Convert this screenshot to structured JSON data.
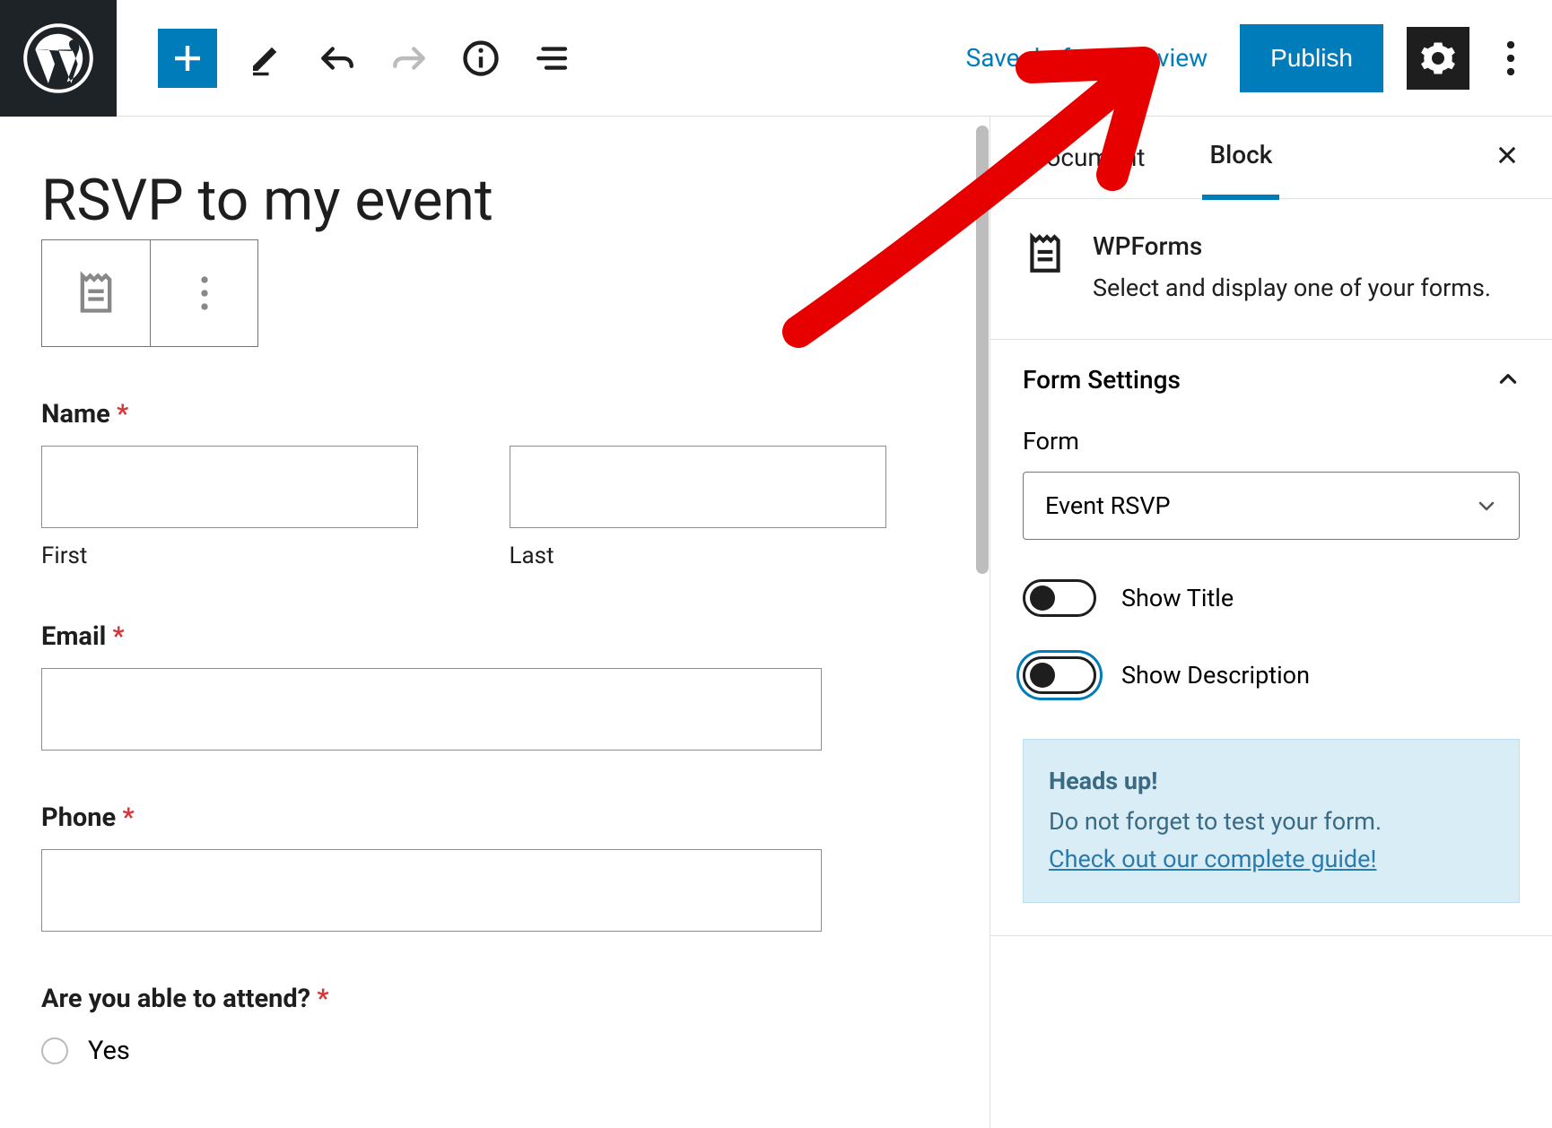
{
  "toolbar": {
    "save_draft": "Save draft",
    "preview": "Preview",
    "publish": "Publish"
  },
  "editor": {
    "title": "RSVP to my event",
    "name_label": "Name",
    "first_label": "First",
    "last_label": "Last",
    "email_label": "Email",
    "phone_label": "Phone",
    "attend_label": "Are you able to attend?",
    "option_yes": "Yes"
  },
  "sidebar": {
    "tabs": {
      "document": "Document",
      "block": "Block"
    },
    "block_name": "WPForms",
    "block_desc": "Select and display one of your forms.",
    "panel_title": "Form Settings",
    "form_label": "Form",
    "form_value": "Event RSVP",
    "toggle_title": "Show Title",
    "toggle_desc": "Show Description",
    "notice_heads": "Heads up!",
    "notice_body": "Do not forget to test your form.",
    "notice_link": "Check out our complete guide!"
  }
}
